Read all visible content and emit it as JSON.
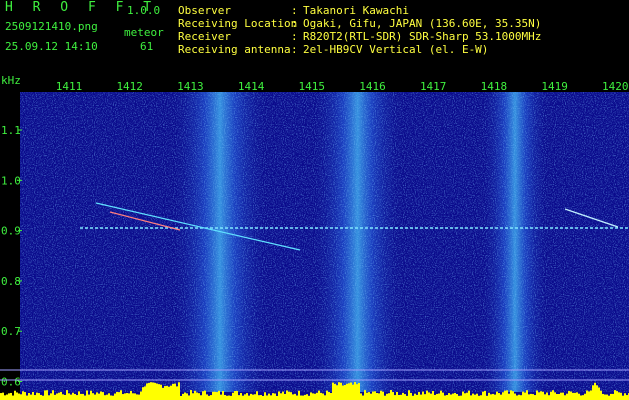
{
  "app": {
    "logo": "H R O F F T",
    "version": "1.0.0"
  },
  "capture": {
    "filename": "2509121410.png",
    "meteor_label": "meteor",
    "meteor_count": "61",
    "timestamp": "25.09.12 14:10"
  },
  "info": [
    {
      "key": "Observer",
      "value": "Takanori Kawachi"
    },
    {
      "key": "Receiving Location",
      "value": "Ogaki, Gifu, JAPAN (136.60E, 35.35N)"
    },
    {
      "key": "Receiver",
      "value": "R820T2(RTL-SDR) SDR-Sharp 53.1000MHz"
    },
    {
      "key": "Receiving antenna",
      "value": "2el-HB9CV Vertical (el. E-W)"
    }
  ],
  "axes": {
    "y_unit": "kHz",
    "y_ticks": [
      "1.1",
      "1.0",
      "0.9",
      "0.8",
      "0.7",
      "0.6"
    ],
    "x_ticks": [
      "1411",
      "1412",
      "1413",
      "1414",
      "1415",
      "1416",
      "1417",
      "1418",
      "1419",
      "1420"
    ]
  },
  "colors": {
    "label_green": "#3ff03f",
    "text_yellow": "#ffff40",
    "background_blue": "#0a0a8c",
    "signal_cyan": "#40ffff",
    "level_yellow": "#ffff00"
  }
}
